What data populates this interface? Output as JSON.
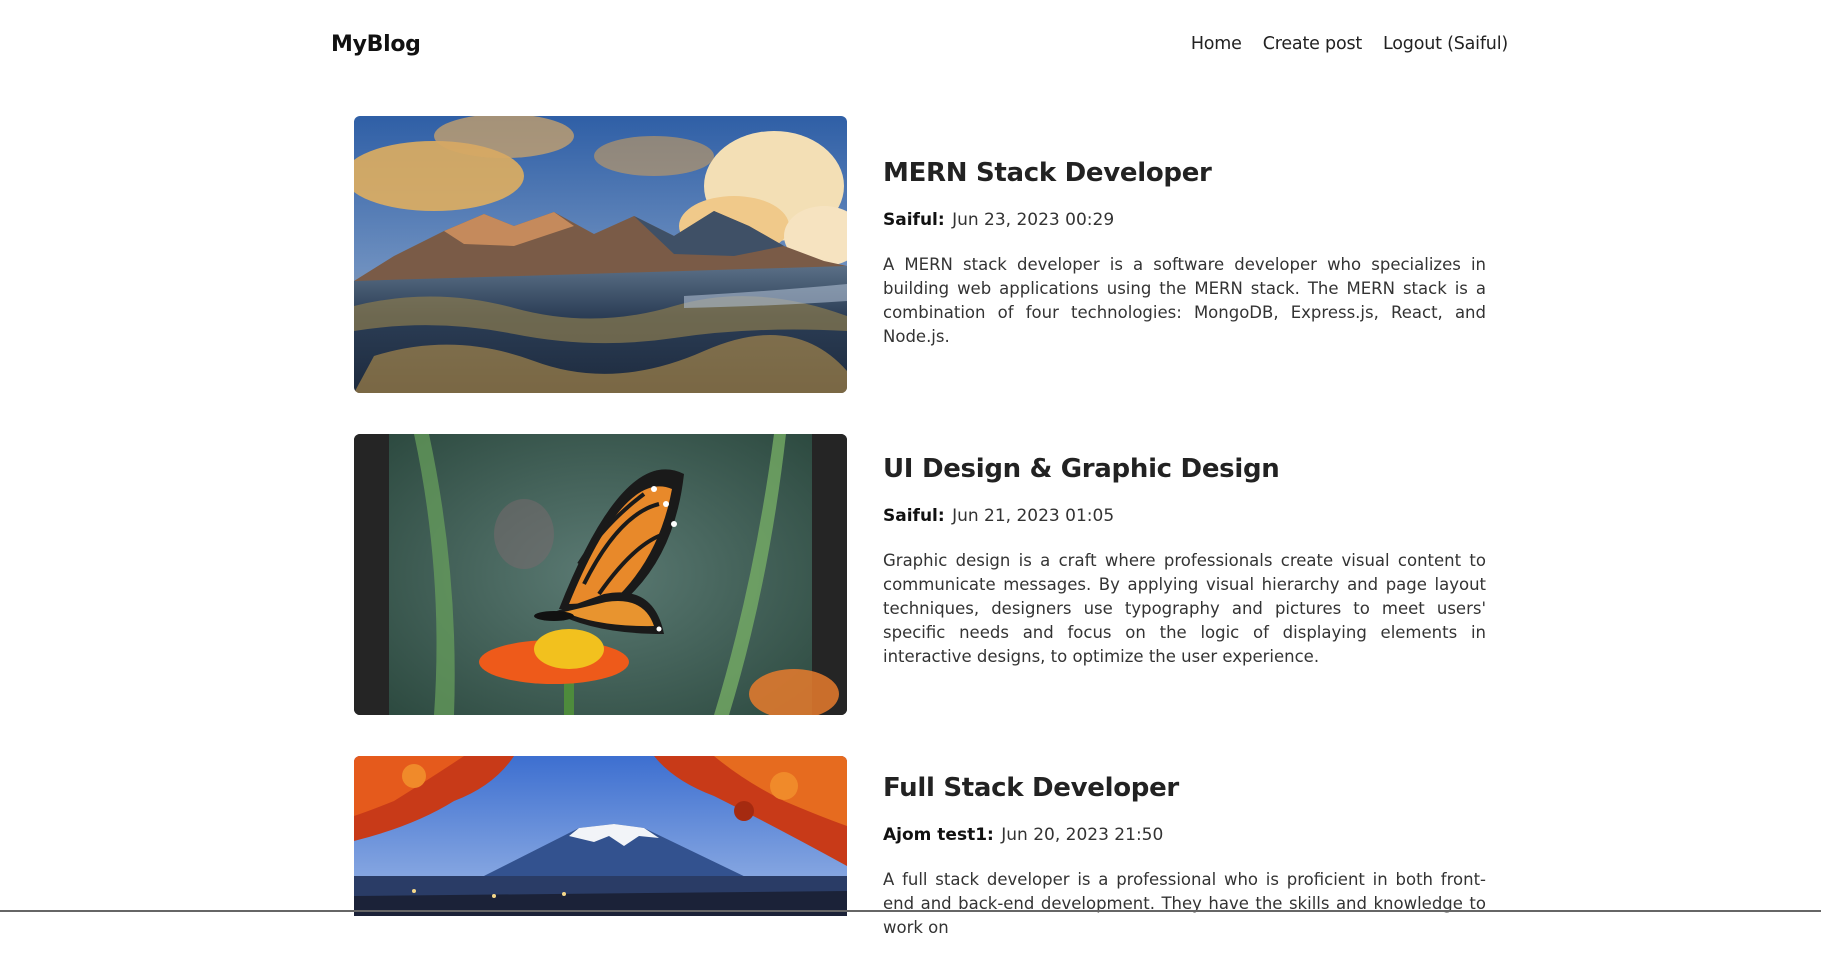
{
  "header": {
    "logo": "MyBlog",
    "nav": [
      {
        "label": "Home"
      },
      {
        "label": "Create post"
      },
      {
        "label": "Logout (Saiful)"
      }
    ]
  },
  "posts": [
    {
      "title": "MERN Stack Developer",
      "author": "Saiful:",
      "time": "Jun 23, 2023 00:29",
      "summary": "A MERN stack developer is a software developer who specializes in building web applications using the MERN stack. The MERN stack is a combination of four technologies: MongoDB, Express.js, React, and Node.js.",
      "image": "mountain-landscape-image"
    },
    {
      "title": "UI Design & Graphic Design",
      "author": "Saiful:",
      "time": "Jun 21, 2023 01:05",
      "summary": "Graphic design is a craft where professionals create visual content to communicate messages. By applying visual hierarchy and page layout techniques, designers use typography and pictures to meet users' specific needs and focus on the logic of displaying elements in interactive designs, to optimize the user experience.",
      "image": "butterfly-image"
    },
    {
      "title": "Full Stack Developer",
      "author": "Ajom test1:",
      "time": "Jun 20, 2023 21:50",
      "summary": "A full stack developer is a professional who is proficient in both front-end and back-end development. They have the skills and knowledge to work on",
      "image": "mount-fuji-image"
    }
  ]
}
